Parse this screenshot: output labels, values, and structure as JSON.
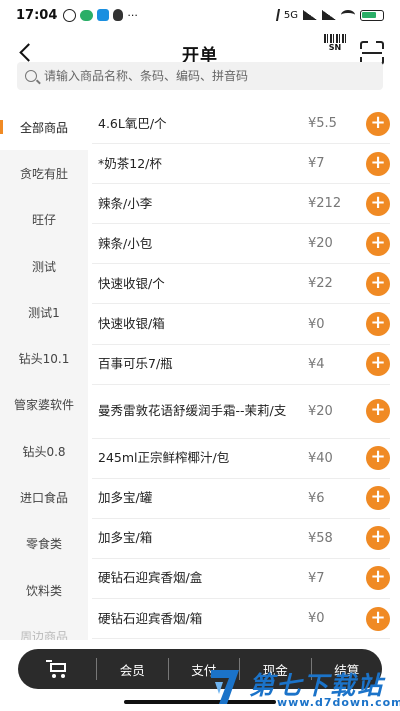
{
  "status_bar": {
    "time": "17:04",
    "network": "5G",
    "battery_color": "#2aae67"
  },
  "header": {
    "title": "开单",
    "barcode_label": "SN"
  },
  "search": {
    "placeholder": "请输入商品名称、条码、编码、拼音码"
  },
  "accent_color": "#f08a24",
  "categories": [
    {
      "label": "全部商品",
      "active": true
    },
    {
      "label": "贪吃有肚"
    },
    {
      "label": "旺仔"
    },
    {
      "label": "测试"
    },
    {
      "label": "测试1"
    },
    {
      "label": "钻头10.1"
    },
    {
      "label": "管家婆软件"
    },
    {
      "label": "钻头0.8"
    },
    {
      "label": "进口食品"
    },
    {
      "label": "零食类"
    },
    {
      "label": "饮料类"
    },
    {
      "label": "周边商品"
    }
  ],
  "products": [
    {
      "name": "4.6L氧巴/个",
      "price": "¥5.5"
    },
    {
      "name": "*奶茶12/杯",
      "price": "¥7"
    },
    {
      "name": "辣条/小李",
      "price": "¥212"
    },
    {
      "name": "辣条/小包",
      "price": "¥20"
    },
    {
      "name": "快速收银/个",
      "price": "¥22"
    },
    {
      "name": "快速收银/箱",
      "price": "¥0"
    },
    {
      "name": "百事可乐7/瓶",
      "price": "¥4"
    },
    {
      "name": "曼秀雷敦花语舒缓润手霜--茉莉/支",
      "price": "¥20"
    },
    {
      "name": "245ml正宗鲜榨椰汁/包",
      "price": "¥40"
    },
    {
      "name": "加多宝/罐",
      "price": "¥6"
    },
    {
      "name": "加多宝/箱",
      "price": "¥58"
    },
    {
      "name": "硬钻石迎宾香烟/盒",
      "price": "¥7"
    },
    {
      "name": "硬钻石迎宾香烟/箱",
      "price": "¥0"
    }
  ],
  "bottom_bar": {
    "buttons": [
      "会员",
      "支付",
      "现金",
      "结算"
    ]
  },
  "watermark": {
    "text": "第七下载站",
    "url": "www.d7down.com"
  }
}
